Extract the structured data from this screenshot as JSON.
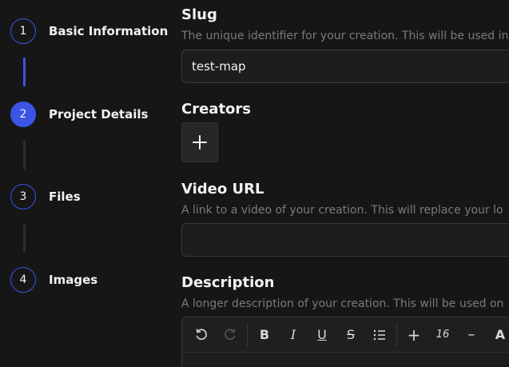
{
  "stepper": {
    "steps": [
      {
        "number": "1",
        "label": "Basic Information",
        "state": "completed"
      },
      {
        "number": "2",
        "label": "Project Details",
        "state": "active"
      },
      {
        "number": "3",
        "label": "Files",
        "state": "pending"
      },
      {
        "number": "4",
        "label": "Images",
        "state": "pending"
      }
    ]
  },
  "form": {
    "slug": {
      "title": "Slug",
      "description": "The unique identifier for your creation. This will be used in",
      "value": "test-map"
    },
    "creators": {
      "title": "Creators",
      "add_icon": "plus-icon"
    },
    "video_url": {
      "title": "Video URL",
      "description": "A link to a video of your creation. This will replace your lo",
      "value": ""
    },
    "description": {
      "title": "Description",
      "description": "A longer description of your creation. This will be used on"
    }
  },
  "editor_toolbar": {
    "undo": "undo-icon",
    "redo": "redo-icon",
    "bold": "B",
    "italic": "I",
    "underline": "U",
    "strike": "S",
    "list": "bullet-list-icon",
    "increase": "+",
    "font_size": "16",
    "decrease": "–",
    "text_color": "A"
  },
  "colors": {
    "background": "#161616",
    "accent": "#3b54e6",
    "input_bg": "#1d1d1d",
    "muted_text": "#7a7a7a"
  }
}
